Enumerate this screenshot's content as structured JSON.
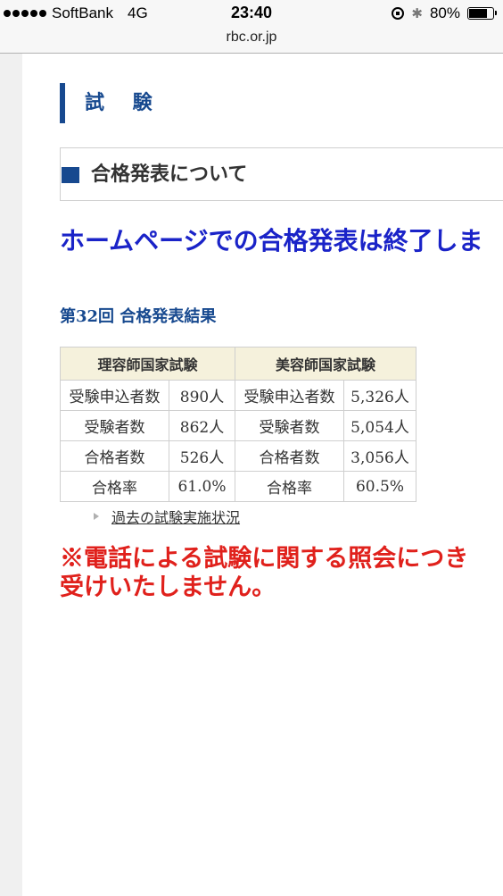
{
  "status_bar": {
    "carrier": "SoftBank",
    "network": "4G",
    "time": "23:40",
    "battery": "80%",
    "battery_level": 0.8
  },
  "browser": {
    "url": "rbc.or.jp"
  },
  "page": {
    "section_title": "試 験",
    "sub_header": "合格発表について",
    "announcement": "ホームページでの合格発表は終了しま",
    "result_title": "第32回 合格発表結果",
    "table": {
      "headers": [
        "理容師国家試験",
        "美容師国家試験"
      ],
      "rows": [
        [
          "受験申込者数",
          "890人",
          "受験申込者数",
          "5,326人"
        ],
        [
          "受験者数",
          "862人",
          "受験者数",
          "5,054人"
        ],
        [
          "合格者数",
          "526人",
          "合格者数",
          "3,056人"
        ],
        [
          "合格率",
          "61.0%",
          "合格率",
          "60.5%"
        ]
      ]
    },
    "past_link": "過去の試験実施状況",
    "notice_line1": "※電話による試験に関する照会につき",
    "notice_line2": "受けいたしません。"
  },
  "colors": {
    "brand_blue": "#17498f",
    "announce_blue": "#1a23c8",
    "notice_red": "#e0211c",
    "table_header_bg": "#f5f1dc"
  }
}
